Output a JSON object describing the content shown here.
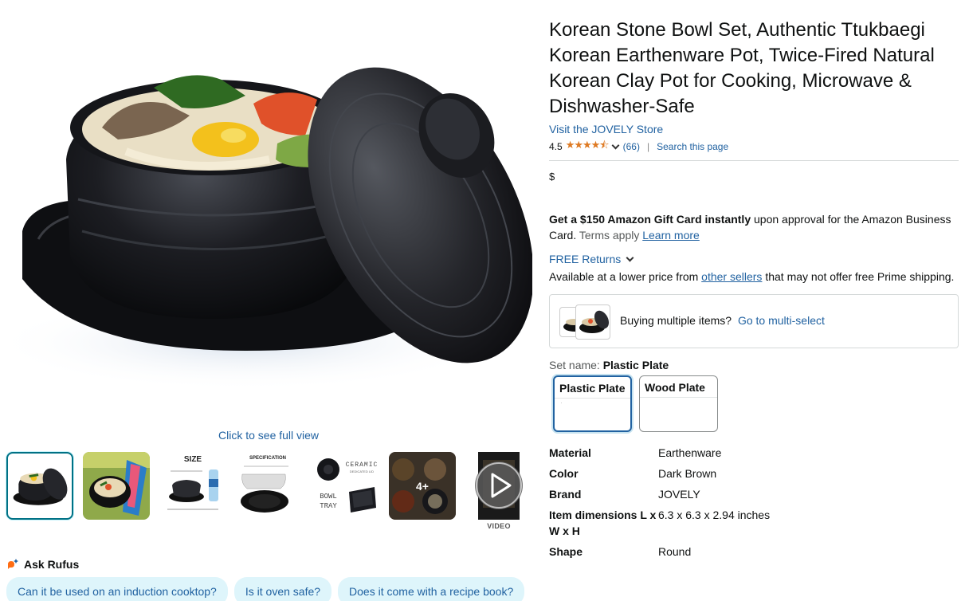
{
  "product": {
    "title": "Korean Stone Bowl Set, Authentic Ttukbaegi Korean Earthenware Pot, Twice-Fired Natural Korean Clay Pot for Cooking, Microwave & Dishwasher-Safe",
    "store_link": "Visit the JOVELY Store",
    "rating": "4.5",
    "stars": "★★★★⯪",
    "rating_count": "(66)",
    "search_page": "Search this page",
    "price_symbol": "$"
  },
  "gallery": {
    "click_full_view": "Click to see full view",
    "thumb_size_label": "SIZE",
    "thumb_spec_label": "SPECIFICATION",
    "thumb_ceramic_label": "CERAMIC",
    "thumb_ceramic_sub": "DEDICATED LID",
    "thumb_tray_label_1": "BOWL",
    "thumb_tray_label_2": "TRAY",
    "thumb_more": "4+",
    "thumb_video_label": "VIDEO"
  },
  "offer": {
    "gift_bold": "Get a $150 Amazon Gift Card instantly",
    "gift_rest": " upon approval for the Amazon Business Card.",
    "terms": " Terms apply ",
    "learn_more": "Learn more",
    "free_returns": "FREE Returns",
    "lower_price_pre": "Available at a lower price from ",
    "other_sellers": "other sellers",
    "lower_price_post": " that may not offer free Prime shipping."
  },
  "multi": {
    "text": "Buying multiple items?",
    "link": "Go to multi-select"
  },
  "set": {
    "label": "Set name: ",
    "selected": "Plastic Plate",
    "options": [
      "Plastic Plate",
      "Wood Plate"
    ]
  },
  "specs": [
    {
      "k": "Material",
      "v": "Earthenware"
    },
    {
      "k": "Color",
      "v": "Dark Brown"
    },
    {
      "k": "Brand",
      "v": "JOVELY"
    },
    {
      "k": "Item dimensions L x W x H",
      "v": "6.3 x 6.3 x 2.94 inches"
    },
    {
      "k": "Shape",
      "v": "Round"
    }
  ],
  "rufus": {
    "title": "Ask Rufus",
    "questions": [
      "Can it be used on an induction cooktop?",
      "Is it oven safe?",
      "Does it come with a recipe book?"
    ]
  },
  "colors": {
    "link": "#2162a1",
    "star": "#de7921",
    "chip_bg": "#def5fb",
    "selected_border": "#007185"
  }
}
